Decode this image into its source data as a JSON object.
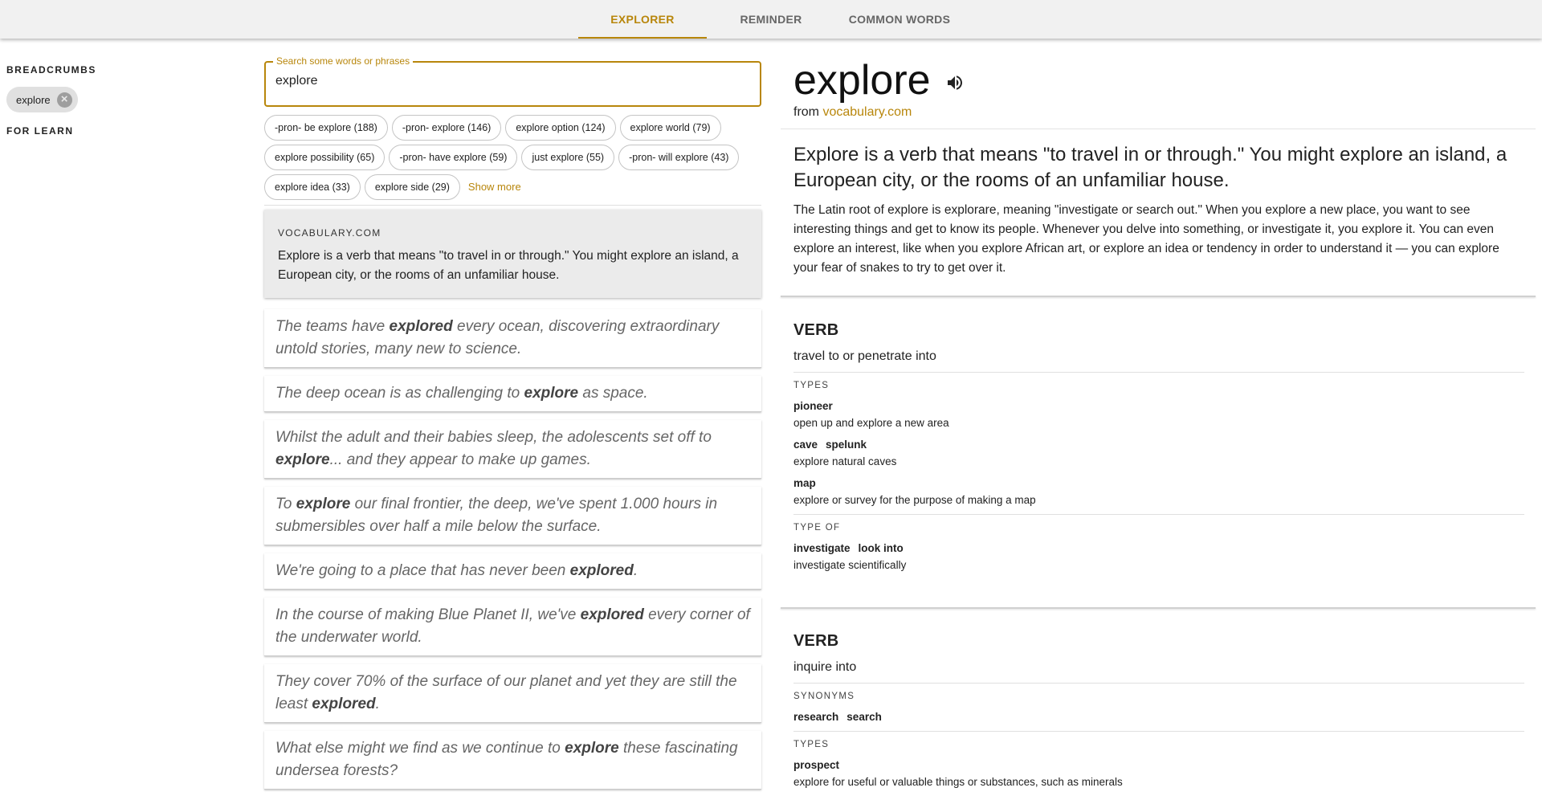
{
  "nav": {
    "tabs": [
      {
        "label": "EXPLORER",
        "active": true
      },
      {
        "label": "REMINDER",
        "active": false
      },
      {
        "label": "COMMON WORDS",
        "active": false
      }
    ]
  },
  "sidebar": {
    "breadcrumbs_heading": "BREADCRUMBS",
    "crumbs": [
      {
        "label": "explore"
      }
    ],
    "for_learn_heading": "FOR LEARN"
  },
  "search": {
    "label": "Search some words or phrases",
    "value": "explore"
  },
  "suggestions": [
    "-pron- be explore (188)",
    "-pron- explore (146)",
    "explore option (124)",
    "explore world (79)",
    "explore possibility (65)",
    "-pron- have explore (59)",
    "just explore (55)",
    "-pron- will explore (43)",
    "explore idea (33)",
    "explore side (29)"
  ],
  "show_more": "Show more",
  "vocab_card": {
    "source": "VOCABULARY.COM",
    "text": "Explore is a verb that means \"to travel in or through.\" You might explore an island, a European city, or the rooms of an unfamiliar house."
  },
  "examples": [
    {
      "before": "The teams have ",
      "bold": "explored",
      "after": " every ocean, discovering extraordinary untold stories, many new to science."
    },
    {
      "before": "The deep ocean is as challenging to ",
      "bold": "explore",
      "after": " as space."
    },
    {
      "before": "Whilst the adult and their babies sleep, the adolescents set off to ",
      "bold": "explore",
      "after": "... and they appear to make up games."
    },
    {
      "before": "To ",
      "bold": "explore",
      "after": " our final frontier, the deep, we've spent 1.000 hours in submersibles over half a mile below the surface."
    },
    {
      "before": "We're going to a place that has never been ",
      "bold": "explored",
      "after": "."
    },
    {
      "before": "In the course of making Blue Planet II, we've ",
      "bold": "explored",
      "after": " every corner of the underwater world."
    },
    {
      "before": "They cover 70% of the surface of our planet and yet they are still the least ",
      "bold": "explored",
      "after": "."
    },
    {
      "before": "What else might we find as we continue to ",
      "bold": "explore",
      "after": " these fascinating undersea forests?"
    }
  ],
  "word": {
    "title": "explore",
    "from_prefix": "from ",
    "source_link": "vocabulary.com",
    "short_def": "Explore is a verb that means \"to travel in or through.\" You might explore an island, a European city, or the rooms of an unfamiliar house.",
    "long_def": "The Latin root of explore is explorare, meaning \"investigate or search out.\" When you explore a new place, you want to see interesting things and get to know its people. Whenever you delve into something, or investigate it, you explore it. You can even explore an interest, like when you explore African art, or explore an idea or tendency in order to understand it — you can explore your fear of snakes to try to get over it."
  },
  "senses": [
    {
      "pos": "VERB",
      "gloss": "travel to or penetrate into",
      "types_label": "TYPES",
      "types": [
        {
          "terms": [
            "pioneer"
          ],
          "def": "open up and explore a new area"
        },
        {
          "terms": [
            "cave",
            "spelunk"
          ],
          "def": "explore natural caves"
        },
        {
          "terms": [
            "map"
          ],
          "def": "explore or survey for the purpose of making a map"
        }
      ],
      "type_of_label": "TYPE OF",
      "type_of": [
        {
          "terms": [
            "investigate",
            "look into"
          ],
          "def": "investigate scientifically"
        }
      ]
    },
    {
      "pos": "VERB",
      "gloss": "inquire into",
      "synonyms_label": "SYNONYMS",
      "synonyms": [
        "research",
        "search"
      ],
      "types_label": "TYPES",
      "types": [
        {
          "terms": [
            "prospect"
          ],
          "def": "explore for useful or valuable things or substances, such as minerals"
        }
      ]
    }
  ]
}
